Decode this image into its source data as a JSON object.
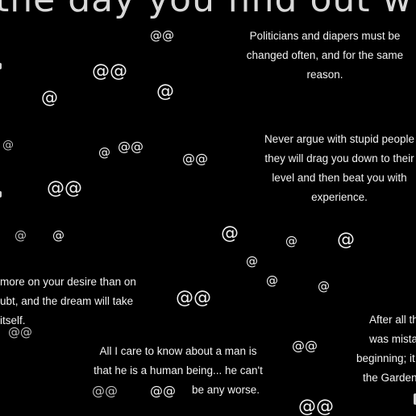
{
  "headline": "the day you find out w",
  "quotes": {
    "politicians": [
      "Politicians and diapers must be",
      "changed often, and for the same",
      "reason."
    ],
    "never_argue": [
      "Never argue with stupid people",
      "they will drag you down to their",
      "level and then beat you with",
      "experience."
    ],
    "desire": [
      "more on your desire than on",
      "ubt, and the dream will take",
      "itself."
    ],
    "after_all": [
      "After all th",
      "was mista",
      "beginning; it",
      "the Garden"
    ],
    "care_to_know": [
      "All I care to know about a man is",
      "that he is a human being... he can't",
      "be any worse."
    ]
  },
  "marks": {
    "single": "@",
    "double": "@@"
  }
}
